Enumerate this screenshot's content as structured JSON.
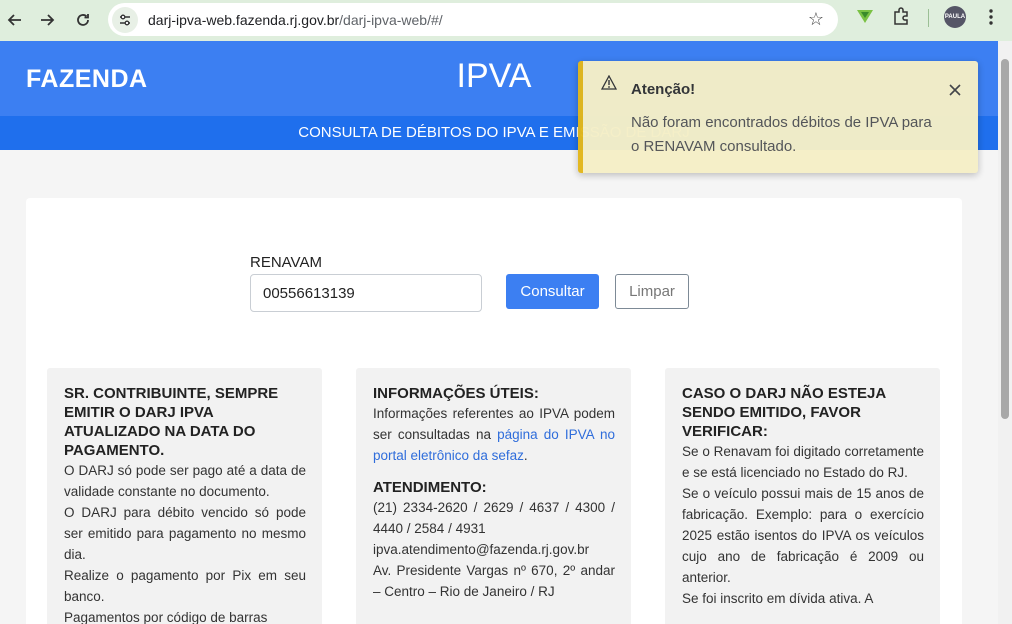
{
  "browser": {
    "url_host": "darj-ipva-web.fazenda.rj.gov.br",
    "url_path": "/darj-ipva-web/#/",
    "profile_label": "PAULA"
  },
  "header": {
    "brand": "FAZENDA",
    "title": "IPVA",
    "subtitle": "CONSULTA DE DÉBITOS DO IPVA E EMISSÃO DE DARJ"
  },
  "form": {
    "renavam_label": "RENAVAM",
    "renavam_value": "00556613139",
    "consultar_label": "Consultar",
    "limpar_label": "Limpar"
  },
  "boxes": {
    "box1": {
      "title": "SR. CONTRIBUINTE, SEMPRE EMITIR O DARJ IPVA ATUALIZADO NA DATA DO PAGAMENTO.",
      "p1": "O DARJ só pode ser pago até a data de validade constante no documento.",
      "p2": "O DARJ para débito vencido só pode ser emitido para pagamento no mesmo dia.",
      "p3": "Realize o pagamento por Pix em seu banco.",
      "p4": "Pagamentos por código de barras"
    },
    "box2": {
      "title": "INFORMAÇÕES ÚTEIS:",
      "p1_before": "Informações referentes ao IPVA podem ser consultadas na ",
      "p1_link": "página do IPVA no portal eletrônico da sefaz",
      "p1_after": ".",
      "title2": "ATENDIMENTO:",
      "phones": "(21) 2334-2620 / 2629 / 4637 / 4300 / 4440 / 2584 / 4931",
      "email": "ipva.atendimento@fazenda.rj.gov.br",
      "address": "Av. Presidente Vargas nº 670, 2º andar – Centro – Rio de Janeiro / RJ"
    },
    "box3": {
      "title": "CASO O DARJ NÃO ESTEJA SENDO EMITIDO, FAVOR VERIFICAR:",
      "p1": "Se o Renavam foi digitado corretamente e se está licenciado no Estado do RJ.",
      "p2": "Se o veículo possui mais de 15 anos de fabricação. Exemplo: para o exercício 2025 estão isentos do IPVA os veículos cujo ano de fabricação é 2009 ou anterior.",
      "p3": "Se foi inscrito em dívida ativa. A"
    }
  },
  "toast": {
    "title": "Atenção!",
    "message": "Não foram encontrados débitos de IPVA para o RENAVAM consultado.",
    "accent_color": "#e3b71b"
  }
}
